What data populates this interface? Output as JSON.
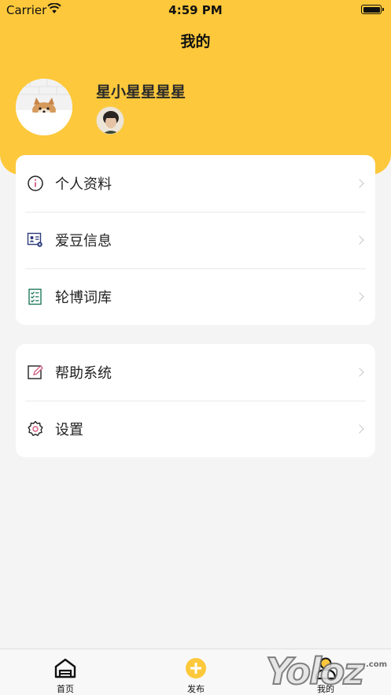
{
  "status_bar": {
    "carrier": "Carrier",
    "time": "4:59 PM"
  },
  "nav": {
    "title": "我的"
  },
  "profile": {
    "username": "星小星星星星"
  },
  "menu_group_1": [
    {
      "label": "个人资料",
      "icon": "info-icon"
    },
    {
      "label": "爱豆信息",
      "icon": "id-card-icon"
    },
    {
      "label": "轮博词库",
      "icon": "checklist-icon"
    }
  ],
  "menu_group_2": [
    {
      "label": "帮助系统",
      "icon": "edit-icon"
    },
    {
      "label": "设置",
      "icon": "gear-icon"
    }
  ],
  "tabbar": {
    "home": "首页",
    "publish": "发布",
    "mine": "我的"
  },
  "watermark": {
    "text": "Yoloz",
    ".com": ".com"
  },
  "colors": {
    "accent": "#fdc83b",
    "background": "#f4f4f4"
  }
}
